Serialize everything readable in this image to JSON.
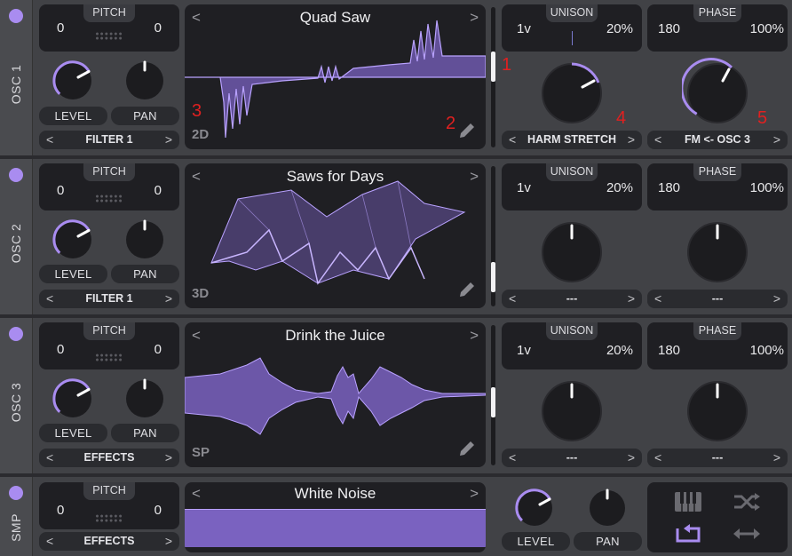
{
  "osc": [
    {
      "label": "OSC 1",
      "pitch": {
        "label": "PITCH",
        "left": "0",
        "right": "0"
      },
      "level_label": "LEVEL",
      "pan_label": "PAN",
      "filter": "FILTER 1",
      "wave": {
        "title": "Quad Saw",
        "mode": "2D"
      },
      "unison": {
        "label": "UNISON",
        "voices": "1v",
        "detune": "20%"
      },
      "phase": {
        "label": "PHASE",
        "value": "180",
        "amount": "100%"
      },
      "mod1": "HARM STRETCH",
      "mod2": "FM <- OSC 3",
      "markers": [
        "1",
        "2",
        "3",
        "4",
        "5"
      ]
    },
    {
      "label": "OSC 2",
      "pitch": {
        "label": "PITCH",
        "left": "0",
        "right": "0"
      },
      "level_label": "LEVEL",
      "pan_label": "PAN",
      "filter": "FILTER 1",
      "wave": {
        "title": "Saws for Days",
        "mode": "3D"
      },
      "unison": {
        "label": "UNISON",
        "voices": "1v",
        "detune": "20%"
      },
      "phase": {
        "label": "PHASE",
        "value": "180",
        "amount": "100%"
      },
      "mod1": "---",
      "mod2": "---"
    },
    {
      "label": "OSC 3",
      "pitch": {
        "label": "PITCH",
        "left": "0",
        "right": "0"
      },
      "level_label": "LEVEL",
      "pan_label": "PAN",
      "filter": "EFFECTS",
      "wave": {
        "title": "Drink the Juice",
        "mode": "SP"
      },
      "unison": {
        "label": "UNISON",
        "voices": "1v",
        "detune": "20%"
      },
      "phase": {
        "label": "PHASE",
        "value": "180",
        "amount": "100%"
      },
      "mod1": "---",
      "mod2": "---"
    }
  ],
  "smp": {
    "label": "SMP",
    "pitch": {
      "label": "PITCH",
      "left": "0",
      "right": "0"
    },
    "dest": "EFFECTS",
    "wave_title": "White Noise",
    "level_label": "LEVEL",
    "pan_label": "PAN"
  },
  "nav": {
    "prev": "<",
    "next": ">"
  },
  "colors": {
    "accent": "#a98cf0",
    "marker": "#e02020",
    "panel": "#1f1f23",
    "background": "#414246"
  }
}
